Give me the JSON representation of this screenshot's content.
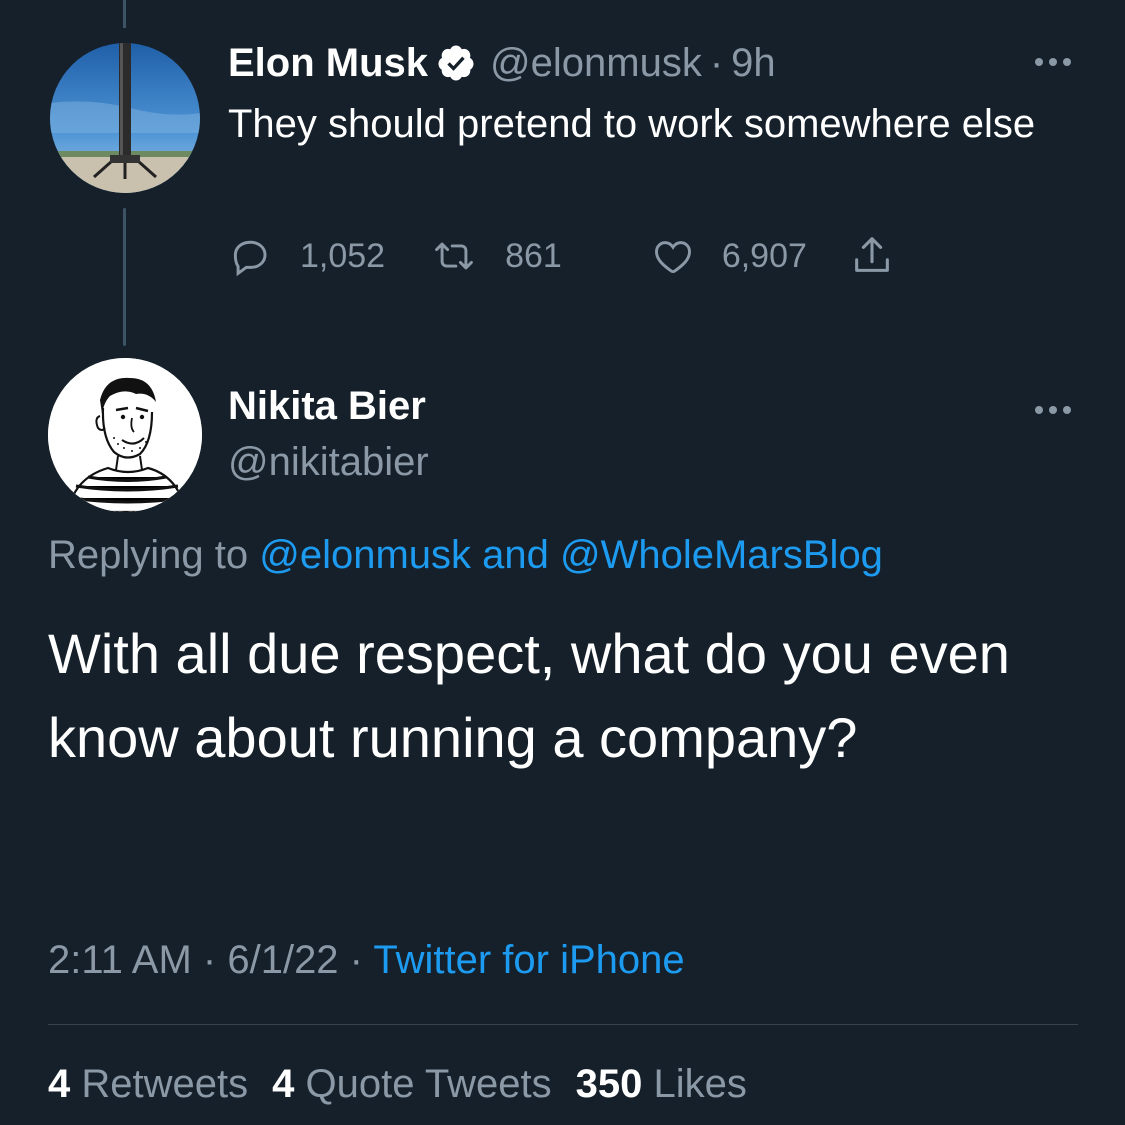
{
  "parent_tweet": {
    "author_name": "Elon Musk",
    "handle": "@elonmusk",
    "separator": "·",
    "time_ago": "9h",
    "text": "They should pretend to work somewhere else",
    "counts": {
      "replies": "1,052",
      "retweets": "861",
      "likes": "6,907"
    }
  },
  "reply_tweet": {
    "author_name": "Nikita Bier",
    "handle": "@nikitabier",
    "replying_prefix": "Replying to ",
    "replying_mention_1": "@elonmusk",
    "replying_joiner": " and ",
    "replying_mention_2": "@WholeMarsBlog",
    "text": "With all due respect, what do you even know about running a company?",
    "time": "2:11 AM",
    "separator": " · ",
    "date": "6/1/22",
    "source": "Twitter for iPhone",
    "stats": {
      "retweets_count": "4",
      "retweets_label": "Retweets",
      "quotes_count": "4",
      "quotes_label": "Quote Tweets",
      "likes_count": "350",
      "likes_label": "Likes"
    }
  },
  "colors": {
    "background": "#15202b",
    "text_primary": "#ffffff",
    "text_secondary": "#8b98a5",
    "accent": "#1d9bf0"
  }
}
